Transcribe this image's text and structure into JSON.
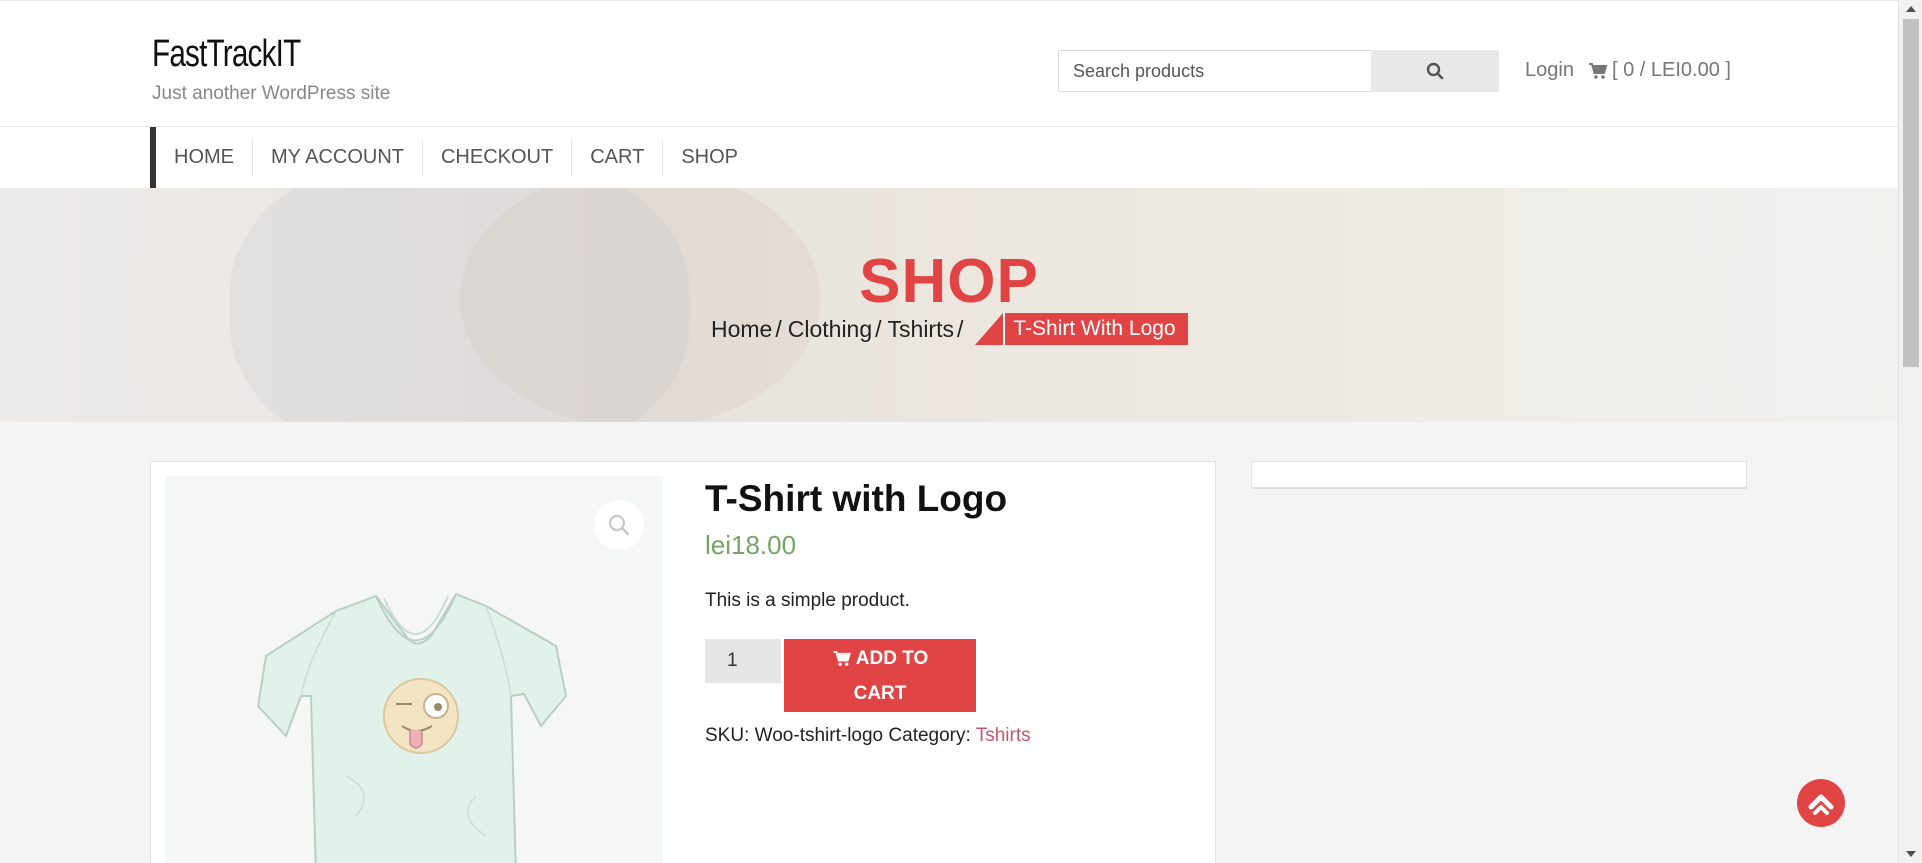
{
  "header": {
    "site_title": "FastTrackIT",
    "tagline": "Just another WordPress site",
    "search_placeholder": "Search products",
    "login_label": "Login",
    "cart_summary": "[ 0 / LEI0.00 ]"
  },
  "nav": {
    "items": [
      {
        "label": "HOME"
      },
      {
        "label": "MY ACCOUNT"
      },
      {
        "label": "CHECKOUT"
      },
      {
        "label": "CART"
      },
      {
        "label": "SHOP"
      }
    ]
  },
  "hero": {
    "title": "SHOP",
    "breadcrumb": [
      "Home",
      "Clothing",
      "Tshirts"
    ],
    "breadcrumb_separator": "/",
    "current": "T-Shirt With Logo"
  },
  "product": {
    "title": "T-Shirt with Logo",
    "price": "lei18.00",
    "description": "This is a simple product.",
    "quantity": "1",
    "add_to_cart_line1": "ADD TO",
    "add_to_cart_line2": "CART",
    "sku_label": "SKU:",
    "sku_value": "Woo-tshirt-logo",
    "category_label": "Category:",
    "category_value": "Tshirts"
  },
  "colors": {
    "accent": "#e04444",
    "price": "#77a464",
    "category_link": "#c8556b"
  },
  "icons": {
    "search": "search-icon",
    "cart": "cart-icon",
    "zoom": "zoom-icon",
    "back_to_top": "chevron-up-icon"
  }
}
